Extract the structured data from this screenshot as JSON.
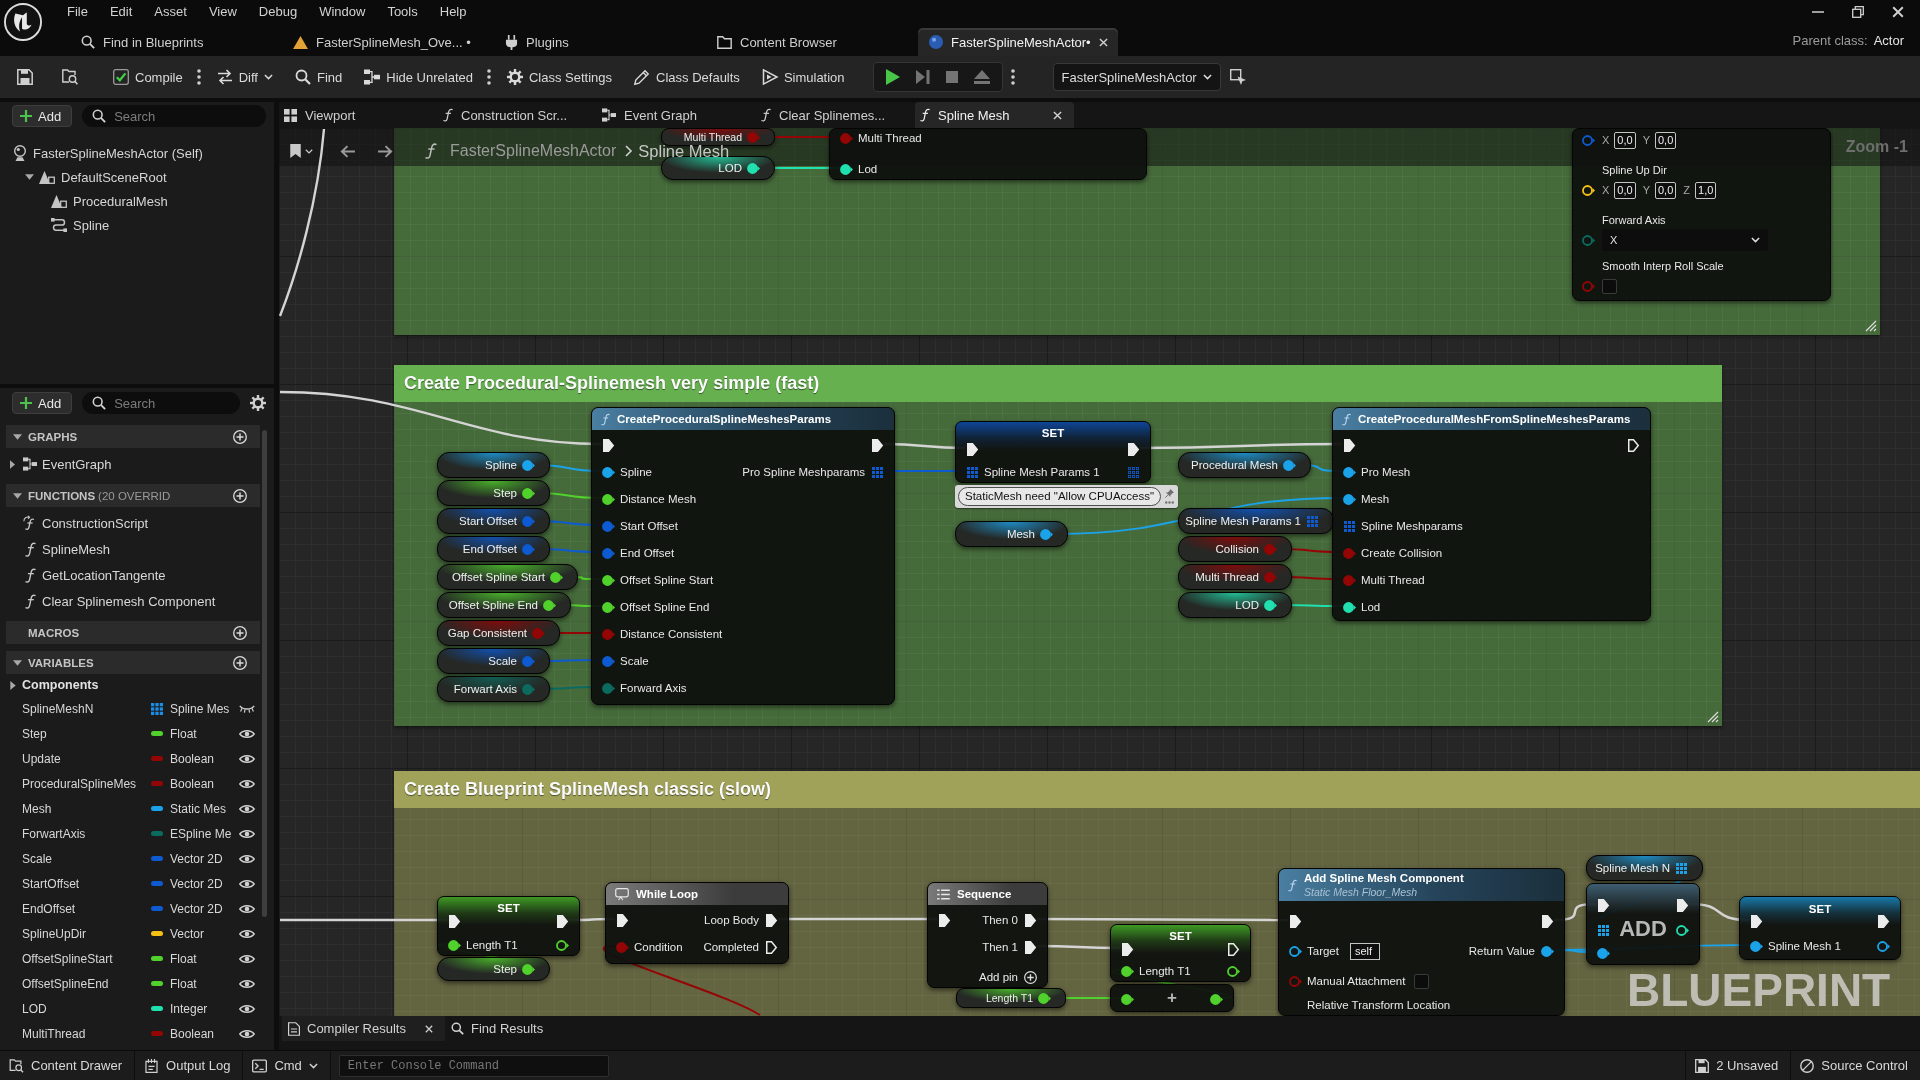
{
  "menu": {
    "items": [
      "File",
      "Edit",
      "Asset",
      "View",
      "Debug",
      "Window",
      "Tools",
      "Help"
    ]
  },
  "app_tabs": [
    {
      "kind": "find",
      "label": "Find in Blueprints",
      "selected": false
    },
    {
      "kind": "asset",
      "label": "FasterSplineMesh_Ove... •",
      "selected": false
    },
    {
      "kind": "plugins",
      "label": "Plugins",
      "selected": false
    },
    {
      "kind": "browser",
      "label": "Content Browser",
      "selected": false
    },
    {
      "kind": "actor",
      "label": "FasterSplineMeshActor•",
      "selected": true
    }
  ],
  "parent_class": {
    "label": "Parent class:",
    "value": "Actor"
  },
  "toolbar": {
    "file_actions": [
      {
        "kind": "save"
      },
      {
        "kind": "browse"
      }
    ],
    "tools": [
      {
        "kind": "compile",
        "label": "Compile"
      },
      {
        "kind": "more"
      },
      {
        "kind": "diff",
        "label": "Diff"
      },
      {
        "kind": "find",
        "label": "Find"
      },
      {
        "kind": "hide",
        "label": "Hide Unrelated"
      },
      {
        "kind": "more"
      },
      {
        "kind": "settings",
        "label": "Class Settings"
      },
      {
        "kind": "defaults",
        "label": "Class Defaults"
      },
      {
        "kind": "simulation",
        "label": "Simulation"
      }
    ],
    "play_controls": [
      {
        "kind": "play",
        "disabled": false
      },
      {
        "kind": "step",
        "disabled": true
      },
      {
        "kind": "stop",
        "disabled": true
      },
      {
        "kind": "eject",
        "disabled": true
      }
    ],
    "debug_object": {
      "value": "FasterSplineMeshActor"
    }
  },
  "components": {
    "add_label": "Add",
    "search_placeholder": "Search",
    "tree": [
      {
        "kind": "self",
        "label": "FasterSplineMeshActor (Self)",
        "children": [
          {
            "kind": "scene",
            "label": "DefaultSceneRoot",
            "expanded": true,
            "children": [
              {
                "kind": "mesh",
                "label": "ProceduralMesh"
              },
              {
                "kind": "spline",
                "label": "Spline"
              }
            ]
          }
        ]
      }
    ]
  },
  "my_blueprint": {
    "add_label": "Add",
    "search_placeholder": "Search",
    "sections": [
      {
        "title": "GRAPHS",
        "expanded": true,
        "items": [
          {
            "kind": "graph",
            "label": "EventGraph",
            "expanded": false
          }
        ]
      },
      {
        "title": "FUNCTIONS",
        "note": "(20 OVERRID",
        "expanded": true,
        "items": [
          {
            "kind": "construction",
            "label": "ConstructionScript"
          },
          {
            "kind": "function",
            "label": "SplineMesh"
          },
          {
            "kind": "function",
            "label": "GetLocationTangente"
          },
          {
            "kind": "function",
            "label": "Clear Splinemesh Component"
          }
        ]
      },
      {
        "title": "MACROS"
      },
      {
        "title": "VARIABLES",
        "expanded": true,
        "categories": [
          {
            "label": "Components",
            "expanded": false
          }
        ],
        "variables": [
          {
            "name": "SplineMeshN",
            "type": "Spline Mes",
            "kind": "array",
            "color": "#1b8fe8",
            "public": false
          },
          {
            "name": "Step",
            "type": "Float",
            "kind": "single",
            "color": "#51d12c",
            "public": true
          },
          {
            "name": "Update",
            "type": "Boolean",
            "kind": "single",
            "color": "#940505",
            "public": true
          },
          {
            "name": "ProceduralSplineMes",
            "type": "Boolean",
            "kind": "single",
            "color": "#940505",
            "public": true
          },
          {
            "name": "Mesh",
            "type": "Static Mes",
            "kind": "single",
            "color": "#1ba3ea",
            "public": true
          },
          {
            "name": "ForwartAxis",
            "type": "ESpline Me",
            "kind": "single",
            "color": "#0b6b5f",
            "public": true
          },
          {
            "name": "Scale",
            "type": "Vector 2D",
            "kind": "single",
            "color": "#0d5ad1",
            "public": true
          },
          {
            "name": "StartOffset",
            "type": "Vector 2D",
            "kind": "single",
            "color": "#0d5ad1",
            "public": true
          },
          {
            "name": "EndOffset",
            "type": "Vector 2D",
            "kind": "single",
            "color": "#0d5ad1",
            "public": true
          },
          {
            "name": "SplineUpDir",
            "type": "Vector",
            "kind": "single",
            "color": "#f5c114",
            "public": true
          },
          {
            "name": "OffsetSplineStart",
            "type": "Float",
            "kind": "single",
            "color": "#51d12c",
            "public": true
          },
          {
            "name": "OffsetSplineEnd",
            "type": "Float",
            "kind": "single",
            "color": "#51d12c",
            "public": true
          },
          {
            "name": "LOD",
            "type": "Integer",
            "kind": "single",
            "color": "#21e0af",
            "public": true
          },
          {
            "name": "MultiThread",
            "type": "Boolean",
            "kind": "single",
            "color": "#940505",
            "public": true
          }
        ]
      }
    ]
  },
  "document_tabs": [
    {
      "kind": "viewport",
      "label": "Viewport",
      "selected": false
    },
    {
      "kind": "function",
      "label": "Construction Scr...",
      "selected": false
    },
    {
      "kind": "graph",
      "label": "Event Graph",
      "selected": false
    },
    {
      "kind": "function",
      "label": "Clear Splinemes...",
      "selected": false
    },
    {
      "kind": "function",
      "label": "Spline Mesh",
      "selected": true
    }
  ],
  "graph": {
    "breadcrumb": [
      "FasterSplineMeshActor",
      "Spline Mesh"
    ],
    "zoom": "Zoom -1",
    "watermark": "BLUEPRINT",
    "comments": [
      {
        "color": "#466b3b"
      },
      {
        "title": "Create Procedural-Splinemesh very simple (fast)",
        "color": "#466b3b"
      },
      {
        "title": "Create Blueprint SplineMesh classic (slow)",
        "color": "#636440"
      }
    ],
    "nodes": [
      {
        "kind": "variable",
        "label": "Multi Thread",
        "pin": {
          "kind": "data",
          "color": "#940505",
          "connected": true
        }
      },
      {
        "kind": "variable",
        "label": "LOD",
        "pin": {
          "kind": "data",
          "color": "#21e0af",
          "connected": true
        }
      },
      {
        "kind": "partial",
        "rows": [
          {
            "in": {
              "kind": "data",
              "label": "Multi Thread",
              "color": "#940505",
              "connected": true
            }
          },
          {
            "in": {
              "kind": "data",
              "label": "Lod",
              "color": "#21e0af",
              "connected": true
            }
          }
        ]
      },
      {
        "kind": "partial",
        "rows": [
          {
            "in": {
              "kind": "data",
              "color": "#0d5ad1",
              "connected": false,
              "fields": [
                {
                  "axis": "X",
                  "value": "0,0"
                },
                {
                  "axis": "Y",
                  "value": "0,0"
                }
              ]
            }
          },
          {
            "in": {
              "kind": "data",
              "label": "Spline Up Dir",
              "color": "#f5c114",
              "connected": false,
              "fields": [
                {
                  "axis": "X",
                  "value": "0,0"
                },
                {
                  "axis": "Y",
                  "value": "0,0"
                },
                {
                  "axis": "Z",
                  "value": "1,0"
                }
              ]
            }
          },
          {
            "in": {
              "kind": "data",
              "label": "Forward Axis",
              "color": "#0b6b5f",
              "connected": false,
              "select": "X"
            }
          },
          {
            "in": {
              "kind": "data",
              "label": "Smooth Interp Roll Scale",
              "color": "#940505",
              "connected": false,
              "checked": false
            }
          }
        ]
      },
      {
        "kind": "variable",
        "label": "Spline",
        "pin": {
          "kind": "data",
          "color": "#1ba3ea",
          "connected": true
        }
      },
      {
        "kind": "variable",
        "label": "Step",
        "pin": {
          "kind": "data",
          "color": "#51d12c",
          "connected": true
        }
      },
      {
        "kind": "variable",
        "label": "Start Offset",
        "pin": {
          "kind": "data",
          "color": "#0d5ad1",
          "connected": true
        }
      },
      {
        "kind": "variable",
        "label": "End Offset",
        "pin": {
          "kind": "data",
          "color": "#0d5ad1",
          "connected": true
        }
      },
      {
        "kind": "variable",
        "label": "Offset Spline Start",
        "pin": {
          "kind": "data",
          "color": "#51d12c",
          "connected": true
        }
      },
      {
        "kind": "variable",
        "label": "Offset Spline End",
        "pin": {
          "kind": "data",
          "color": "#51d12c",
          "connected": true
        }
      },
      {
        "kind": "variable",
        "label": "Gap Consistent",
        "pin": {
          "kind": "data",
          "color": "#940505",
          "connected": true
        }
      },
      {
        "kind": "variable",
        "label": "Scale",
        "pin": {
          "kind": "data",
          "color": "#0d5ad1",
          "connected": true
        }
      },
      {
        "kind": "variable",
        "label": "Forwart Axis",
        "pin": {
          "kind": "data",
          "color": "#0b6b5f",
          "connected": true
        }
      },
      {
        "kind": "function",
        "title": "CreateProceduralSplineMeshesParams",
        "rows": [
          {
            "in": {
              "kind": "exec",
              "connected": true
            },
            "out": {
              "kind": "exec",
              "connected": true
            }
          },
          {
            "in": {
              "kind": "data",
              "label": "Spline",
              "color": "#1ba3ea",
              "connected": true
            },
            "out": {
              "kind": "array",
              "label": "Pro Spline Meshparams",
              "color": "#0d5ad1",
              "connected": true
            }
          },
          {
            "in": {
              "kind": "data",
              "label": "Distance Mesh",
              "color": "#51d12c",
              "connected": true
            }
          },
          {
            "in": {
              "kind": "data",
              "label": "Start Offset",
              "color": "#0d5ad1",
              "connected": true
            }
          },
          {
            "in": {
              "kind": "data",
              "label": "End Offset",
              "color": "#0d5ad1",
              "connected": true
            }
          },
          {
            "in": {
              "kind": "data",
              "label": "Offset Spline Start",
              "color": "#51d12c",
              "connected": true
            }
          },
          {
            "in": {
              "kind": "data",
              "label": "Offset Spline End",
              "color": "#51d12c",
              "connected": true
            }
          },
          {
            "in": {
              "kind": "data",
              "label": "Distance Consistent",
              "color": "#940505",
              "connected": true
            }
          },
          {
            "in": {
              "kind": "data",
              "label": "Scale",
              "color": "#0d5ad1",
              "connected": true
            }
          },
          {
            "in": {
              "kind": "data",
              "label": "Forward Axis",
              "color": "#0b6b5f",
              "connected": true
            }
          }
        ]
      },
      {
        "kind": "set",
        "title": "SET",
        "rows": [
          {
            "in": {
              "kind": "exec",
              "connected": true
            },
            "out": {
              "kind": "exec",
              "connected": true
            }
          },
          {
            "in": {
              "kind": "array",
              "label": "Spline Mesh Params 1",
              "color": "#0d5ad1",
              "connected": true
            },
            "out": {
              "kind": "array",
              "color": "#0d5ad1",
              "connected": false
            }
          }
        ]
      },
      {
        "kind": "variable",
        "label": "Mesh",
        "comment": "StaticMesh need \"Allow CPUAccess\"",
        "pin": {
          "kind": "data",
          "color": "#1ba3ea",
          "connected": true
        }
      },
      {
        "kind": "variable",
        "label": "Procedural Mesh",
        "pin": {
          "kind": "data",
          "color": "#1ba3ea",
          "connected": true
        }
      },
      {
        "kind": "variable",
        "label": "Spline Mesh Params 1",
        "pin": {
          "kind": "array",
          "color": "#0d5ad1",
          "connected": true
        }
      },
      {
        "kind": "variable",
        "label": "Collision",
        "pin": {
          "kind": "data",
          "color": "#940505",
          "connected": true
        }
      },
      {
        "kind": "variable",
        "label": "Multi Thread",
        "pin": {
          "kind": "data",
          "color": "#940505",
          "connected": true
        }
      },
      {
        "kind": "variable",
        "label": "LOD",
        "pin": {
          "kind": "data",
          "color": "#21e0af",
          "connected": true
        }
      },
      {
        "kind": "function",
        "title": "CreateProceduralMeshFromSplineMeshesParams",
        "rows": [
          {
            "in": {
              "kind": "exec",
              "connected": true
            },
            "out": {
              "kind": "exec",
              "connected": false
            }
          },
          {
            "in": {
              "kind": "data",
              "label": "Pro Mesh",
              "color": "#1ba3ea",
              "connected": true
            }
          },
          {
            "in": {
              "kind": "data",
              "label": "Mesh",
              "color": "#1ba3ea",
              "connected": true
            }
          },
          {
            "in": {
              "kind": "array",
              "label": "Spline Meshparams",
              "color": "#0d5ad1",
              "connected": true
            }
          },
          {
            "in": {
              "kind": "data",
              "label": "Create Collision",
              "color": "#940505",
              "connected": true
            }
          },
          {
            "in": {
              "kind": "data",
              "label": "Multi Thread",
              "color": "#940505",
              "connected": true
            }
          },
          {
            "in": {
              "kind": "data",
              "label": "Lod",
              "color": "#21e0af",
              "connected": true
            }
          }
        ]
      },
      {
        "kind": "set",
        "title": "SET",
        "rows": [
          {
            "in": {
              "kind": "exec",
              "connected": true
            },
            "out": {
              "kind": "exec",
              "connected": true
            }
          },
          {
            "in": {
              "kind": "data",
              "label": "Length T1",
              "color": "#51d12c",
              "connected": true
            },
            "out": {
              "kind": "data",
              "color": "#51d12c",
              "connected": false
            }
          }
        ]
      },
      {
        "kind": "variable",
        "label": "Step",
        "pin": {
          "kind": "data",
          "color": "#51d12c",
          "connected": true
        }
      },
      {
        "kind": "macro",
        "title": "While Loop",
        "rows": [
          {
            "in": {
              "kind": "exec",
              "connected": true
            },
            "out": {
              "kind": "exec",
              "label": "Loop Body",
              "connected": true
            }
          },
          {
            "in": {
              "kind": "data",
              "label": "Condition",
              "color": "#940505",
              "connected": true
            },
            "out": {
              "kind": "exec",
              "label": "Completed",
              "connected": false
            }
          }
        ]
      },
      {
        "kind": "sequence",
        "title": "Sequence",
        "rows": [
          {
            "in": {
              "kind": "exec",
              "connected": true
            },
            "out": {
              "kind": "exec",
              "label": "Then 0",
              "connected": true
            }
          },
          {
            "out": {
              "kind": "exec",
              "label": "Then 1",
              "connected": true
            }
          },
          {
            "out": {
              "kind": "add",
              "label": "Add pin"
            }
          }
        ]
      },
      {
        "kind": "variable",
        "label": "Length T1",
        "pin": {
          "kind": "data",
          "color": "#51d12c",
          "connected": true
        }
      },
      {
        "kind": "set",
        "title": "SET",
        "rows": [
          {
            "in": {
              "kind": "exec",
              "connected": true
            },
            "out": {
              "kind": "exec",
              "connected": false
            }
          },
          {
            "in": {
              "kind": "data",
              "label": "Length T1",
              "color": "#51d12c",
              "connected": true
            },
            "out": {
              "kind": "data",
              "color": "#51d12c",
              "connected": false
            }
          }
        ]
      },
      {
        "kind": "math",
        "symbol": "+",
        "rows": [
          {
            "in": {
              "kind": "data",
              "color": "#51d12c",
              "connected": true
            },
            "out": {
              "kind": "data",
              "color": "#51d12c",
              "connected": true
            }
          }
        ]
      },
      {
        "kind": "function",
        "title": "Add Spline Mesh Component",
        "subtitle": "Static Mesh Floor_Mesh",
        "rows": [
          {
            "in": {
              "kind": "exec",
              "connected": true
            },
            "out": {
              "kind": "exec",
              "connected": true
            }
          },
          {
            "in": {
              "kind": "data",
              "label": "Target",
              "color": "#1ba3ea",
              "connected": false,
              "value": "self"
            },
            "out": {
              "kind": "data",
              "label": "Return Value",
              "color": "#1ba3ea",
              "connected": true
            }
          },
          {
            "in": {
              "kind": "data",
              "label": "Manual Attachment",
              "color": "#940505",
              "connected": false,
              "checked": false
            }
          },
          {
            "in": {
              "label": "Relative Transform Location"
            }
          }
        ]
      },
      {
        "kind": "variable",
        "label": "Spline Mesh N",
        "pin": {
          "kind": "array",
          "color": "#1ba3ea",
          "connected": true
        }
      },
      {
        "kind": "array-add",
        "title": "ADD",
        "rows": [
          {
            "in": {
              "kind": "exec",
              "connected": true
            },
            "out": {
              "kind": "exec",
              "connected": true
            }
          },
          {
            "in": {
              "kind": "array",
              "color": "#1ba3ea",
              "connected": true
            },
            "out": {
              "kind": "data",
              "color": "#21e0af",
              "connected": false
            }
          },
          {
            "in": {
              "kind": "data",
              "color": "#1ba3ea",
              "connected": true
            }
          }
        ]
      },
      {
        "kind": "set",
        "title": "SET",
        "rows": [
          {
            "in": {
              "kind": "exec",
              "connected": true
            },
            "out": {
              "kind": "exec",
              "connected": true
            }
          },
          {
            "in": {
              "kind": "data",
              "label": "Spline Mesh 1",
              "color": "#1ba3ea",
              "connected": true
            },
            "out": {
              "kind": "data",
              "color": "#1ba3ea",
              "connected": false
            }
          }
        ]
      }
    ]
  },
  "bottom_tabs": [
    {
      "kind": "compiler",
      "label": "Compiler Results",
      "selected": true
    },
    {
      "kind": "find",
      "label": "Find Results",
      "selected": false
    }
  ],
  "status_bar": {
    "buttons": [
      {
        "kind": "drawer",
        "label": "Content Drawer"
      },
      {
        "kind": "log",
        "label": "Output Log"
      },
      {
        "kind": "cmd",
        "label": "Cmd"
      }
    ],
    "console_placeholder": "Enter Console Command",
    "right": [
      {
        "kind": "unsaved",
        "label": "2 Unsaved"
      },
      {
        "kind": "source",
        "label": "Source Control"
      }
    ]
  }
}
